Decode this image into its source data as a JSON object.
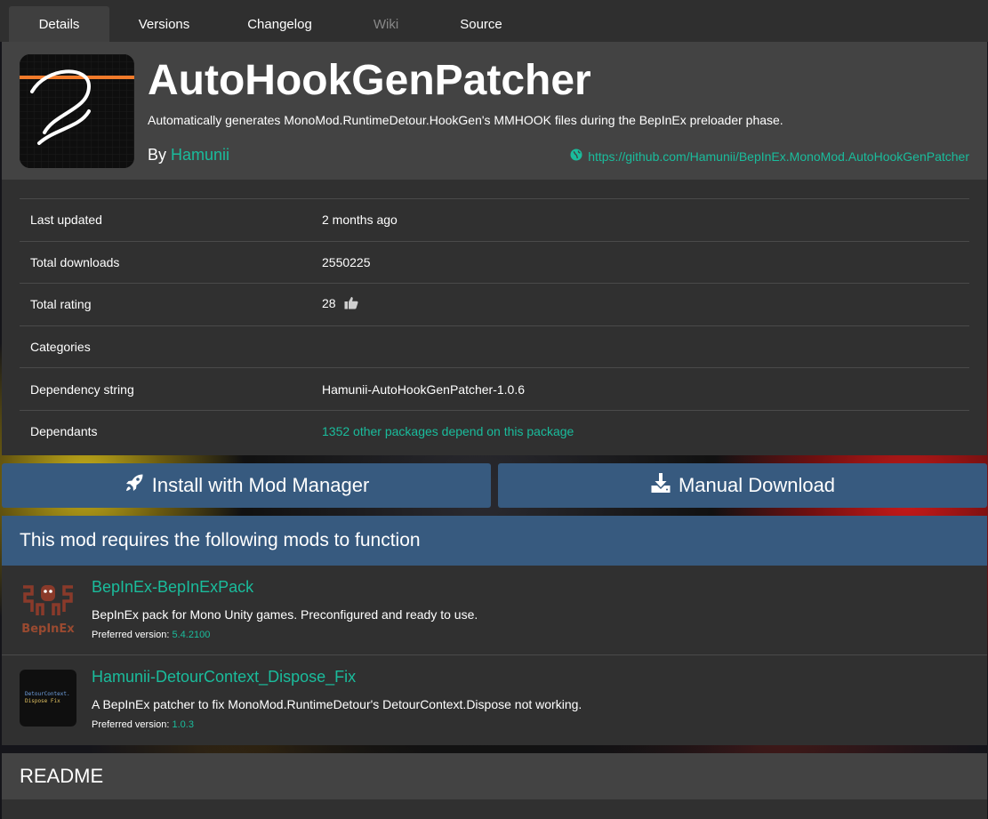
{
  "tabs": [
    {
      "label": "Details",
      "active": true
    },
    {
      "label": "Versions"
    },
    {
      "label": "Changelog"
    },
    {
      "label": "Wiki",
      "disabled": true
    },
    {
      "label": "Source"
    }
  ],
  "package": {
    "name": "AutoHookGenPatcher",
    "description": "Automatically generates MonoMod.RuntimeDetour.HookGen's MMHOOK files during the BepInEx preloader phase.",
    "by_label": "By",
    "author": "Hamunii",
    "repo_url": "https://github.com/Hamunii/BepInEx.MonoMod.AutoHookGenPatcher"
  },
  "info": {
    "last_updated_label": "Last updated",
    "last_updated": "2 months ago",
    "total_downloads_label": "Total downloads",
    "total_downloads": "2550225",
    "total_rating_label": "Total rating",
    "total_rating": "28",
    "categories_label": "Categories",
    "categories": "",
    "dependency_string_label": "Dependency string",
    "dependency_string": "Hamunii-AutoHookGenPatcher-1.0.6",
    "dependants_label": "Dependants",
    "dependants": "1352 other packages depend on this package"
  },
  "buttons": {
    "install": "Install with Mod Manager",
    "download": "Manual Download"
  },
  "dependencies": {
    "heading": "This mod requires the following mods to function",
    "items": [
      {
        "name": "BepInEx-BepInExPack",
        "description": "BepInEx pack for Mono Unity games. Preconfigured and ready to use.",
        "version_label": "Preferred version:",
        "version": "5.4.2100",
        "icon_text": "BepInEx"
      },
      {
        "name": "Hamunii-DetourContext_Dispose_Fix",
        "description": "A BepInEx patcher to fix MonoMod.RuntimeDetour's DetourContext.Dispose not working.",
        "version_label": "Preferred version:",
        "version": "1.0.3",
        "icon_text_1": "DetourContext.",
        "icon_text_2": "Dispose Fix"
      }
    ]
  },
  "readme": {
    "heading": "README"
  },
  "colors": {
    "accent": "#1abc9c",
    "primary": "#375a7f",
    "card": "#303030",
    "header": "#434343"
  }
}
